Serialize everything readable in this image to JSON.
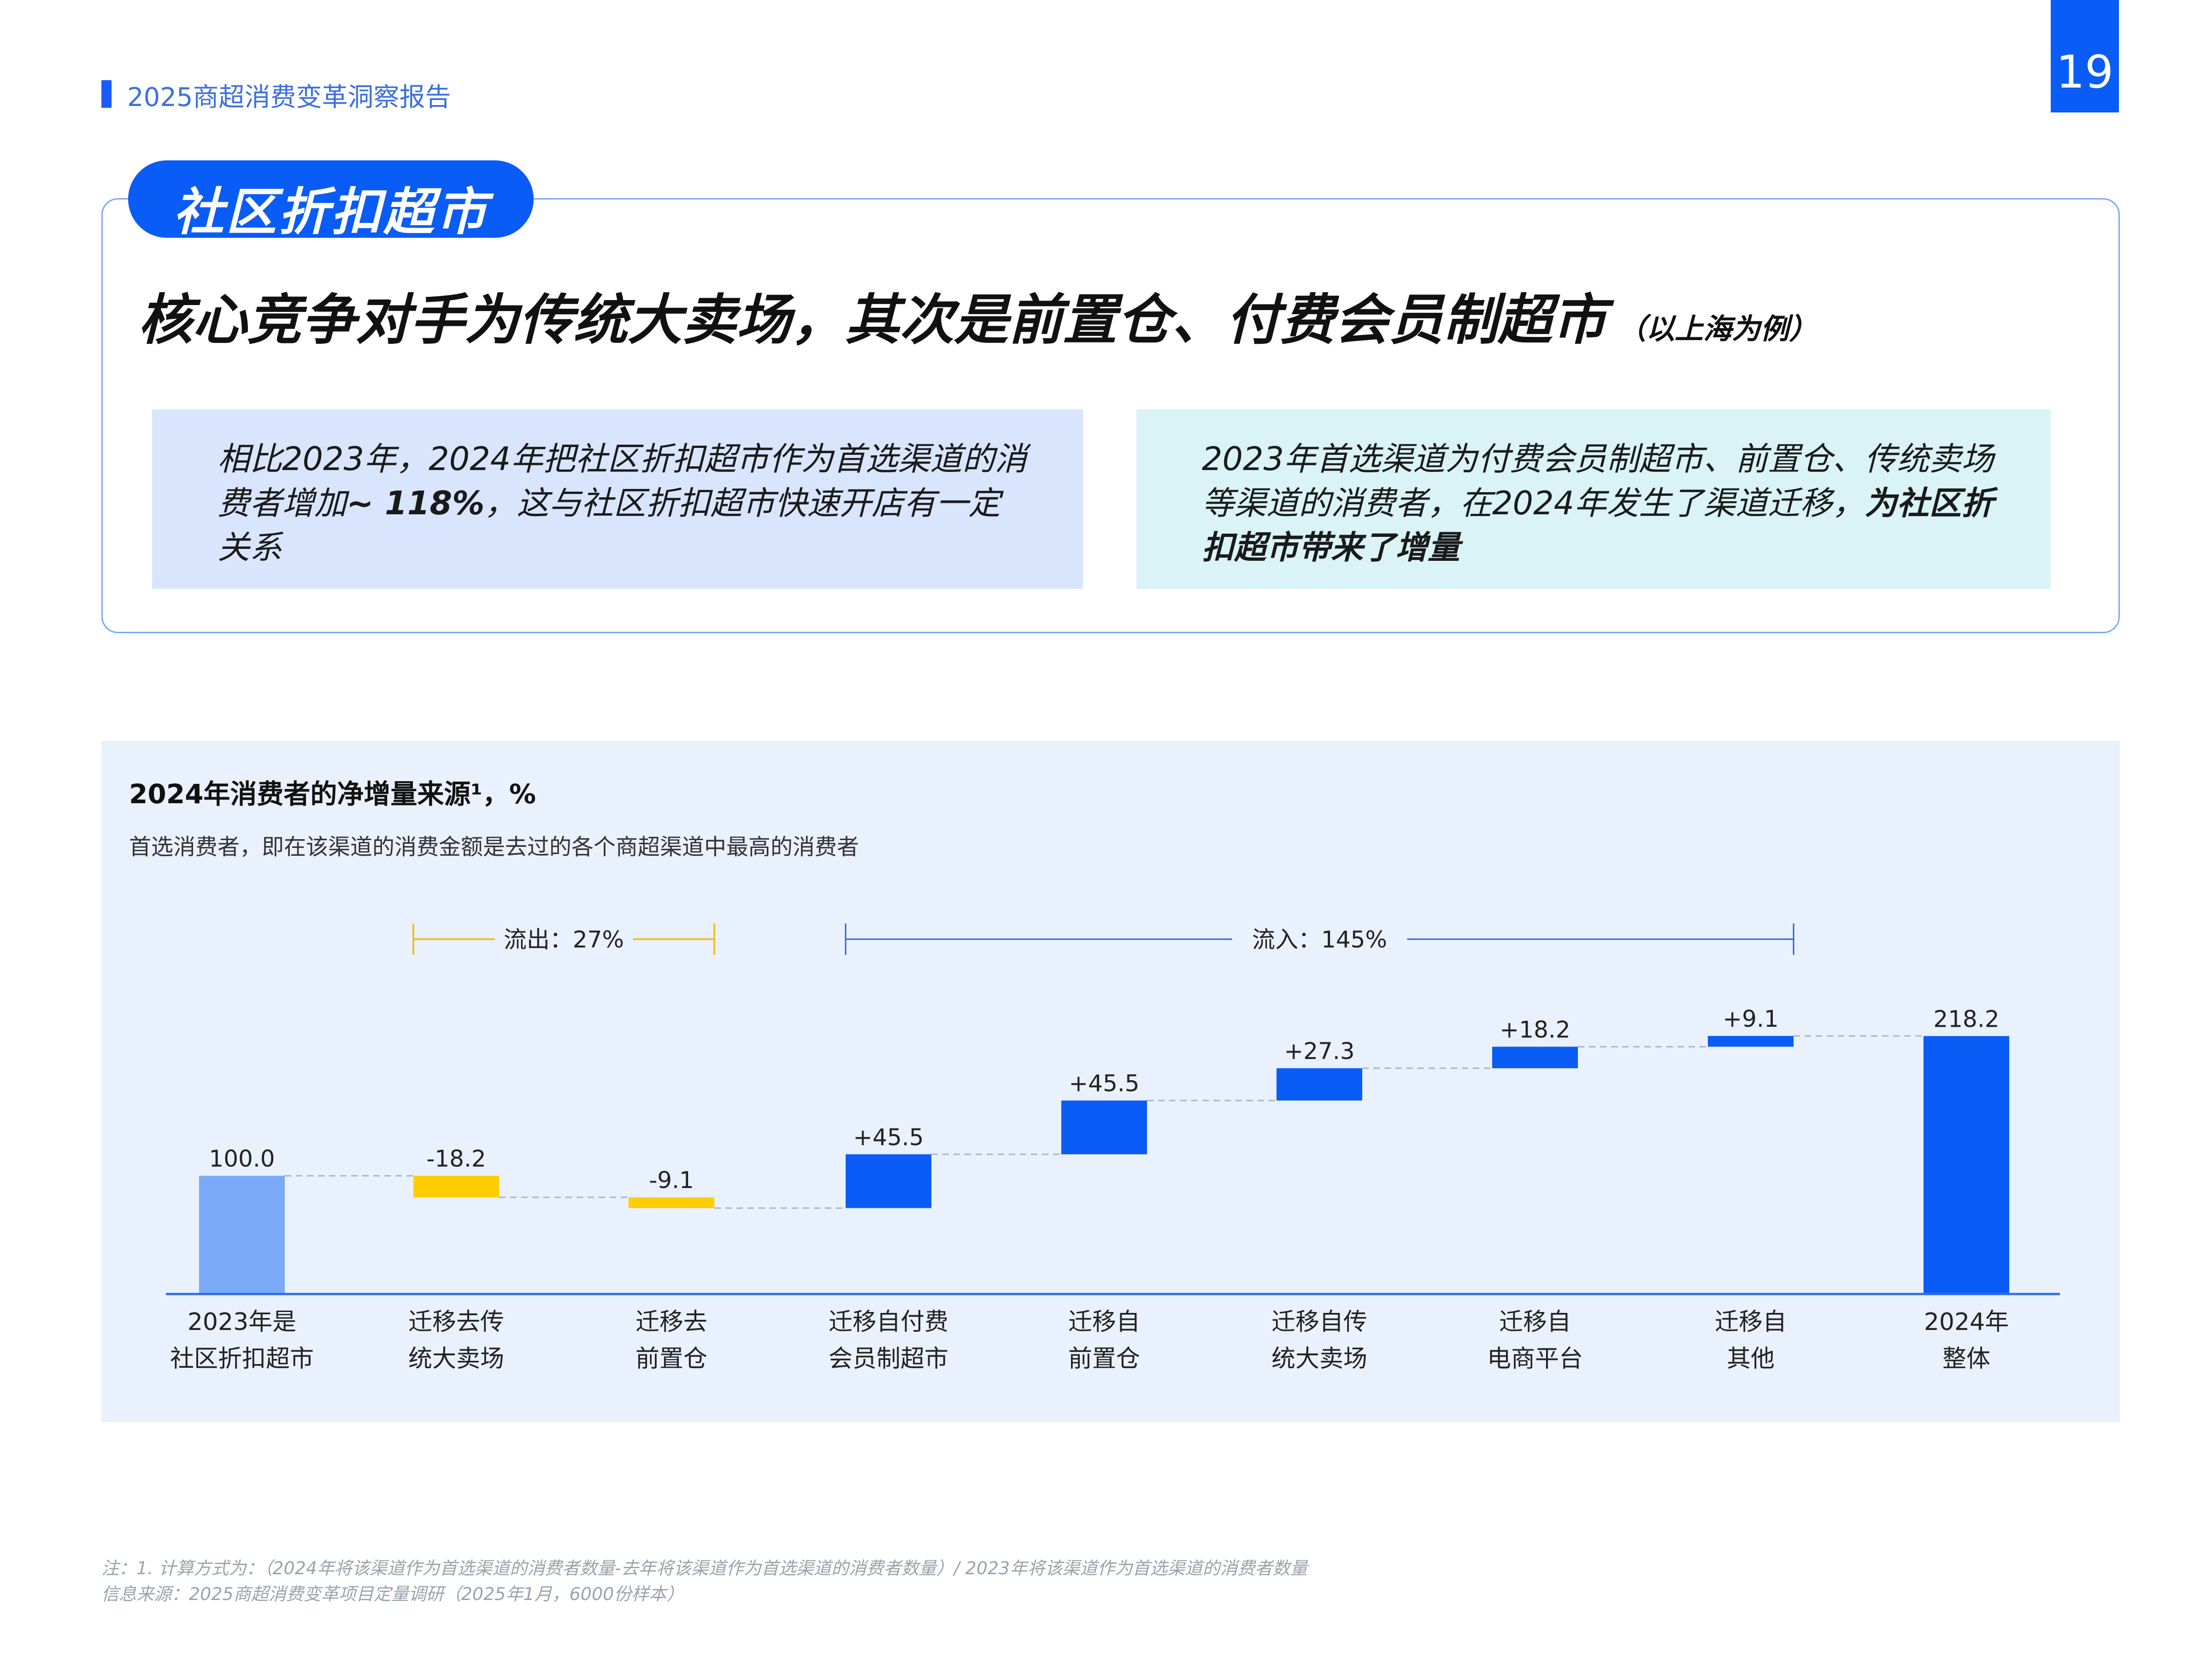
{
  "header": {
    "report_title": "2025商超消费变革洞察报告",
    "page_number": "19"
  },
  "section": {
    "pill_label": "社区折扣超市"
  },
  "headline": {
    "main": "核心竞争对手为传统大卖场，其次是前置仓、付费会员制超市",
    "note": "（以上海为例）"
  },
  "boxes": {
    "left": {
      "text1": "相比2023年，2024年把社区折扣超市作为首选渠道的消费者增加",
      "bold": "~ 118%",
      "text2": "，这与社区折扣超市快速开店有一定关系"
    },
    "right": {
      "text1": "2023年首选渠道为付费会员制超市、前置仓、传统卖场等渠道的消费者，在2024年发生了渠道迁移，",
      "bold": "为社区折扣超市带来了增量"
    }
  },
  "chart_data": {
    "type": "bar",
    "subtype": "waterfall",
    "title": "2024年消费者的净增量来源¹，%",
    "subtitle": "首选消费者，即在该渠道的消费金额是去过的各个商超渠道中最高的消费者",
    "categories": [
      [
        "2023年是",
        "社区折扣超市"
      ],
      [
        "迁移去传",
        "统大卖场"
      ],
      [
        "迁移去",
        "前置仓"
      ],
      [
        "迁移自付费",
        "会员制超市"
      ],
      [
        "迁移自",
        "前置仓"
      ],
      [
        "迁移自传",
        "统大卖场"
      ],
      [
        "迁移自",
        "电商平台"
      ],
      [
        "迁移自",
        "其他"
      ],
      [
        "2024年",
        "整体"
      ]
    ],
    "values": [
      100.0,
      -18.2,
      -9.1,
      45.5,
      45.5,
      27.3,
      18.2,
      9.1,
      218.2
    ],
    "labels": [
      "100.0",
      "-18.2",
      "-9.1",
      "+45.5",
      "+45.5",
      "+27.3",
      "+18.2",
      "+9.1",
      "218.2"
    ],
    "kinds": [
      "start",
      "decrease",
      "decrease",
      "increase",
      "increase",
      "increase",
      "increase",
      "increase",
      "total"
    ],
    "ylim": [
      0,
      230
    ],
    "colors": {
      "start": "#7aaaf7",
      "decrease": "#ffcd00",
      "increase": "#0a5cf6",
      "total": "#0a5cf6",
      "axis": "#2f6fe4",
      "connector": "#aab4c2"
    },
    "brackets": [
      {
        "label": "流出：27%",
        "from_index": 1,
        "to_index": 2,
        "color": "#f0c020"
      },
      {
        "label": "流入：145%",
        "from_index": 3,
        "to_index": 7,
        "color": "#2a63d0"
      }
    ]
  },
  "footnotes": {
    "note": "注：1. 计算方式为：（2024年将该渠道作为首选渠道的消费者数量-去年将该渠道作为首选渠道的消费者数量）/ 2023年将该渠道作为首选渠道的消费者数量",
    "source": "信息来源：2025商超消费变革项目定量调研（2025年1月，6000份样本）"
  }
}
